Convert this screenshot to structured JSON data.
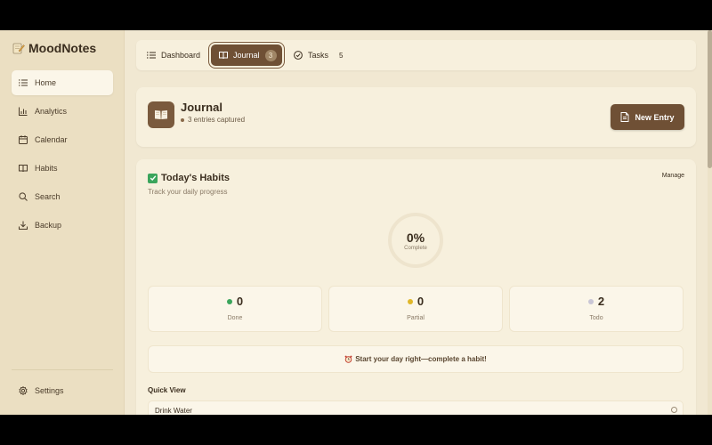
{
  "sidebar": {
    "brand": "MoodNotes",
    "items": [
      {
        "label": "Home",
        "icon": "list-icon",
        "active": true
      },
      {
        "label": "Analytics",
        "icon": "bar-chart-icon"
      },
      {
        "label": "Calendar",
        "icon": "calendar-icon"
      },
      {
        "label": "Habits",
        "icon": "book-open-icon"
      },
      {
        "label": "Search",
        "icon": "search-icon"
      },
      {
        "label": "Backup",
        "icon": "download-icon"
      }
    ],
    "settings_label": "Settings"
  },
  "tabs": {
    "dashboard": {
      "label": "Dashboard"
    },
    "journal": {
      "label": "Journal",
      "count": "3"
    },
    "tasks": {
      "label": "Tasks",
      "count": "5"
    }
  },
  "journal": {
    "title": "Journal",
    "subtitle": "3 entries captured",
    "new_entry_label": "New Entry"
  },
  "habits": {
    "title": "Today's Habits",
    "subtitle": "Track your daily progress",
    "manage_label": "Manage",
    "progress": {
      "value": "0%",
      "label": "Complete"
    },
    "stats": {
      "done": {
        "value": "0",
        "label": "Done",
        "color": "#3ba55c"
      },
      "partial": {
        "value": "0",
        "label": "Partial",
        "color": "#e0b72a"
      },
      "todo": {
        "value": "2",
        "label": "Todo",
        "color": "#c9c6d6"
      }
    },
    "motivation": "Start your day right—complete a habit!",
    "quick_view_title": "Quick View",
    "quick_view_items": [
      "Drink Water"
    ]
  },
  "colors": {
    "accent": "#6f5035",
    "background": "#f1e8d2",
    "card": "#f7f0dd"
  }
}
